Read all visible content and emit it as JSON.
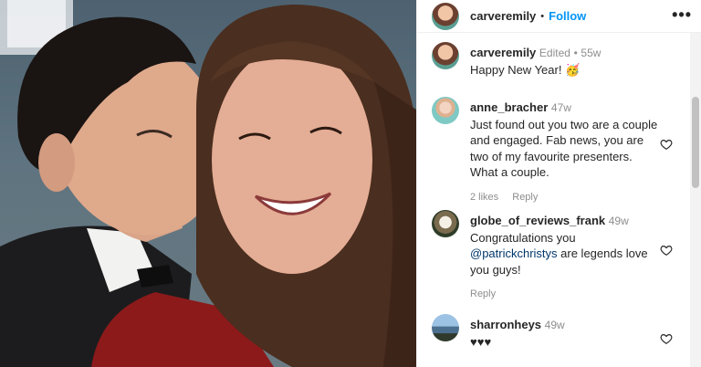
{
  "post": {
    "author": "carveremily",
    "follow_label": "Follow",
    "separator": "•",
    "more_label": "•••"
  },
  "caption": {
    "username": "carveremily",
    "edited": "Edited",
    "separator": "•",
    "time": "55w",
    "text": "Happy New Year! 🥳"
  },
  "comments": [
    {
      "username": "anne_bracher",
      "time": "47w",
      "text": "Just found out you two are a couple and engaged. Fab news, you are two of my favourite presenters. What a couple.",
      "likes": "2 likes",
      "reply_label": "Reply"
    },
    {
      "username": "globe_of_reviews_frank",
      "time": "49w",
      "text_before": "Congratulations you ",
      "mention": "@patrickchristys",
      "text_after": " are legends love you guys!",
      "reply_label": "Reply"
    },
    {
      "username": "sharronheys",
      "time": "49w",
      "text": "♥♥♥"
    }
  ],
  "icons": {
    "like": "heart-outline-icon",
    "more": "more-options-icon"
  },
  "colors": {
    "follow": "#0095f6",
    "mention": "#00376b",
    "meta": "#8e8e8e"
  }
}
